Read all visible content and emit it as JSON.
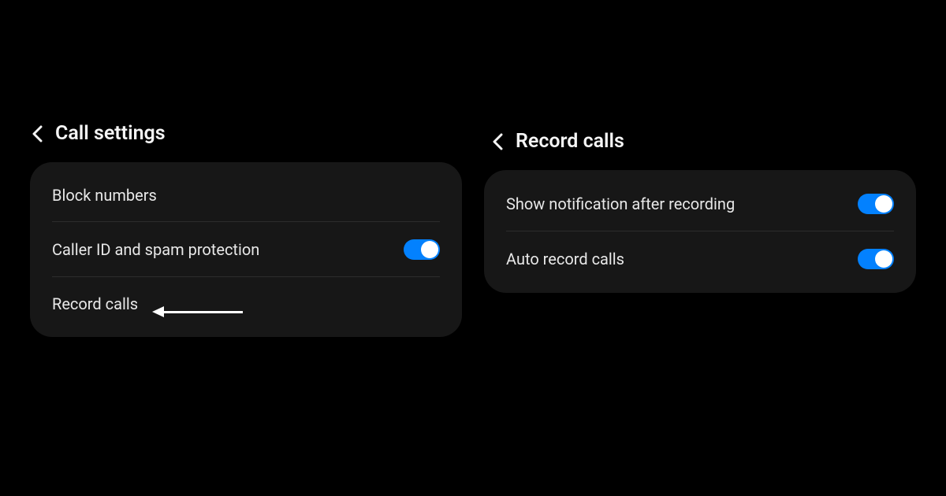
{
  "left_panel": {
    "title": "Call settings",
    "items": [
      {
        "label": "Block numbers",
        "has_toggle": false
      },
      {
        "label": "Caller ID and spam protection",
        "has_toggle": true,
        "toggle_on": true
      },
      {
        "label": "Record calls",
        "has_toggle": false
      }
    ]
  },
  "right_panel": {
    "title": "Record calls",
    "items": [
      {
        "label": "Show notification after recording",
        "has_toggle": true,
        "toggle_on": true
      },
      {
        "label": "Auto record calls",
        "has_toggle": true,
        "toggle_on": true
      }
    ]
  },
  "colors": {
    "accent": "#0381fe",
    "background": "#000000",
    "card": "#171717"
  }
}
